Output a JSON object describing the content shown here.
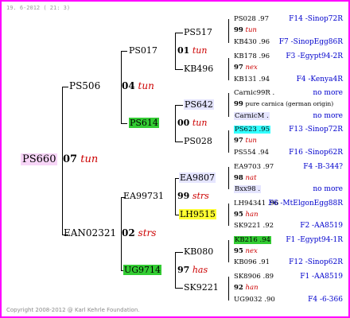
{
  "header": "19. 6-2012 ( 21: 3)",
  "footer": "Copyright 2008-2012 @ Karl Kehrle Foundation.",
  "root": {
    "name": "PS660",
    "year": "07",
    "breed": "tun"
  },
  "gen1": [
    {
      "name": "PS506",
      "year": "04",
      "breed": "tun"
    },
    {
      "name": "EAN02321",
      "year": "02",
      "breed": "strs"
    }
  ],
  "gen2": [
    {
      "name": "PS017",
      "year": "01",
      "breed": "tun"
    },
    {
      "name": "PS614",
      "year": "00",
      "breed": "tun"
    },
    {
      "name": "EA99731",
      "year": "99",
      "breed": "strs"
    },
    {
      "name": "UG9714",
      "year": "97",
      "breed": "has"
    }
  ],
  "gen3": [
    {
      "name": "PS517"
    },
    {
      "name": "KB496"
    },
    {
      "name": "PS642"
    },
    {
      "name": "PS028"
    },
    {
      "name": "EA9807"
    },
    {
      "name": "LH9515"
    },
    {
      "name": "KB080"
    },
    {
      "name": "SK9221"
    }
  ],
  "gen4": [
    {
      "top": "PS028 .97",
      "topRight": "F14 -Sinop72R",
      "year": "99",
      "breed": "tun",
      "bottom": "KB430 .96",
      "bottomRight": "F7 -SinopEgg86R"
    },
    {
      "top": "KB178 .96",
      "topRight": "F3 -Egypt94-2R",
      "year": "97",
      "breed": "nex",
      "bottom": "KB131 .94",
      "bottomRight": "F4 -Kenya4R"
    },
    {
      "top": "Carnic99R .",
      "topRight": "no more",
      "year": "99",
      "breed": "pure carnica (german origin)",
      "bottom": "CarnicM .",
      "bottomRight": "no more"
    },
    {
      "top": "PS623 .95",
      "topRight": "F13 -Sinop72R",
      "year": "97",
      "breed": "tun",
      "bottom": "PS554 .94",
      "bottomRight": "F16 -Sinop62R"
    },
    {
      "top": "EA9703 .97",
      "topRight": "F4 -B-344?",
      "year": "98",
      "breed": "nat",
      "bottom": "Bxx98 .",
      "bottomRight": "no more"
    },
    {
      "top": "LH94341 .96",
      "topRight": "F6 -MtElgonEgg88R",
      "year": "95",
      "breed": "han",
      "bottom": "SK9221 .92",
      "bottomRight": "F2 -AA8519"
    },
    {
      "top": "KB216 .94",
      "topRight": "F1 -Egypt94-1R",
      "year": "95",
      "breed": "nex",
      "bottom": "KB096 .91",
      "bottomRight": "F12 -Sinop62R"
    },
    {
      "top": "SK8906 .89",
      "topRight": "F1 -AA8519",
      "year": "92",
      "breed": "han",
      "bottom": "UG9032 .90",
      "bottomRight": "F4 -6-366"
    }
  ]
}
